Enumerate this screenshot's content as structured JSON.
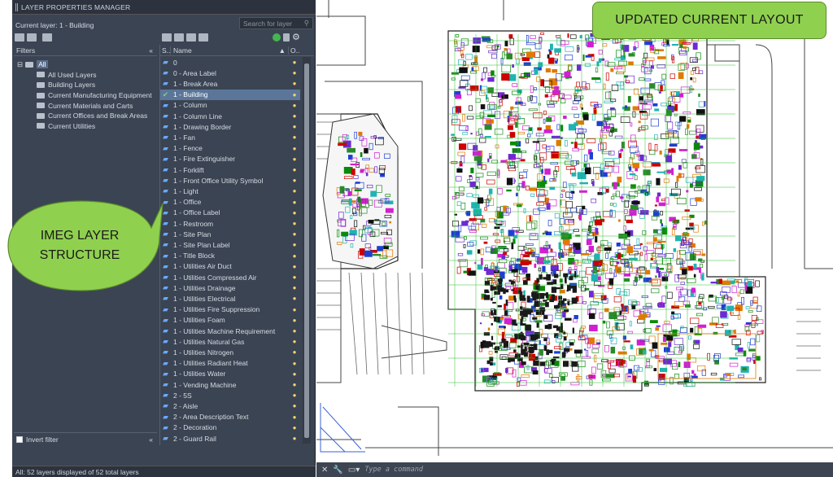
{
  "panel": {
    "title": "LAYER PROPERTIES MANAGER",
    "current_layer": "Current layer: 1 - Building",
    "search_placeholder": "Search for layer",
    "filters_header": "Filters",
    "column_status": "S..",
    "column_name": "Name",
    "column_on": "O..",
    "invert_filter": "Invert filter",
    "status_text": "All: 52 layers displayed of 52 total layers"
  },
  "filters_tree": [
    {
      "label": "All",
      "level": 0,
      "selected": true
    },
    {
      "label": "All Used Layers",
      "level": 1
    },
    {
      "label": "Building Layers",
      "level": 1
    },
    {
      "label": "Current Manufacturing Equipment",
      "level": 1
    },
    {
      "label": "Current Materials and Carts",
      "level": 1
    },
    {
      "label": "Current Offices and Break Areas",
      "level": 1
    },
    {
      "label": "Current Utilities",
      "level": 1
    }
  ],
  "layers": [
    {
      "name": "0"
    },
    {
      "name": "0 - Area Label"
    },
    {
      "name": "1 - Break Area"
    },
    {
      "name": "1 - Building",
      "current": true
    },
    {
      "name": "1 - Column"
    },
    {
      "name": "1 - Column Line"
    },
    {
      "name": "1 - Drawing Border"
    },
    {
      "name": "1 - Fan"
    },
    {
      "name": "1 - Fence"
    },
    {
      "name": "1 - Fire Extinguisher"
    },
    {
      "name": "1 - Forklift"
    },
    {
      "name": "1 - Front Office Utility Symbol"
    },
    {
      "name": "1 - Light"
    },
    {
      "name": "1 - Office"
    },
    {
      "name": "1 - Office Label"
    },
    {
      "name": "1 - Restroom"
    },
    {
      "name": "1 - Site Plan"
    },
    {
      "name": "1 - Site Plan Label"
    },
    {
      "name": "1 - Title Block"
    },
    {
      "name": "1 - Utilities Air Duct"
    },
    {
      "name": "1 - Utilities Compressed Air"
    },
    {
      "name": "1 - Utilities Drainage"
    },
    {
      "name": "1 - Utilities Electrical"
    },
    {
      "name": "1 - Utilities Fire Suppression"
    },
    {
      "name": "1 - Utilities Foam"
    },
    {
      "name": "1 - Utilities Machine Requirement"
    },
    {
      "name": "1 - Utilities Natural Gas"
    },
    {
      "name": "1 - Utilities Nitrogen"
    },
    {
      "name": "1 - Utilities Radiant Heat"
    },
    {
      "name": "1 - Utilities Water"
    },
    {
      "name": "1 - Vending Machine"
    },
    {
      "name": "2 - 5S"
    },
    {
      "name": "2 - Aisle"
    },
    {
      "name": "2 - Area Description Text"
    },
    {
      "name": "2 - Decoration"
    },
    {
      "name": "2 - Guard Rail"
    }
  ],
  "command_line": {
    "placeholder": "Type a command"
  },
  "callouts": {
    "top": "UPDATED CURRENT LAYOUT",
    "bubble_line1": "IMEG LAYER",
    "bubble_line2": "STRUCTURE"
  },
  "colors": {
    "callout_green": "#8fd14f",
    "panel_bg": "#3b4453",
    "selected_row": "#5b7699"
  }
}
